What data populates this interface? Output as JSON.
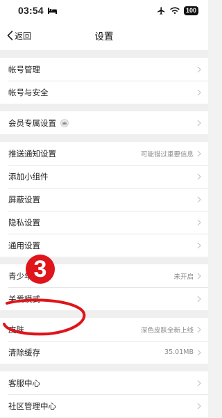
{
  "status_bar": {
    "time": "03:54",
    "battery": "100"
  },
  "nav": {
    "back_label": "返回",
    "title": "设置"
  },
  "groups": [
    {
      "items": [
        {
          "label": "帐号管理",
          "value": ""
        },
        {
          "label": "帐号与安全",
          "value": ""
        }
      ]
    },
    {
      "items": [
        {
          "label": "会员专属设置",
          "value": ""
        }
      ]
    },
    {
      "items": [
        {
          "label": "推送通知设置",
          "value": "可能错过重要信息"
        },
        {
          "label": "添加小组件",
          "value": ""
        },
        {
          "label": "屏蔽设置",
          "value": ""
        },
        {
          "label": "隐私设置",
          "value": ""
        },
        {
          "label": "通用设置",
          "value": ""
        }
      ]
    },
    {
      "items": [
        {
          "label": "青少年模式",
          "value": "未开启"
        },
        {
          "label": "关爱模式",
          "value": ""
        }
      ]
    },
    {
      "items": [
        {
          "label": "皮肤",
          "value": "深色皮肤全新上线"
        },
        {
          "label": "清除缓存",
          "value": "35.01MB"
        }
      ]
    },
    {
      "items": [
        {
          "label": "客服中心",
          "value": ""
        },
        {
          "label": "社区管理中心",
          "value": ""
        }
      ]
    }
  ],
  "annotation": {
    "step_number": "3"
  },
  "colors": {
    "annotation_red": "#e0141b",
    "chevron": "#c4c4c4"
  }
}
